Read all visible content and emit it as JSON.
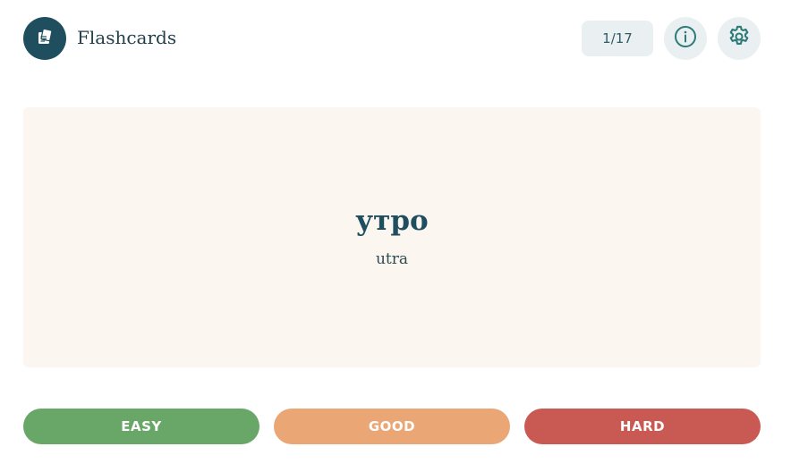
{
  "header": {
    "app_title": "Flashcards",
    "logo_icon": "notes-icon",
    "counter": "1/17",
    "info_icon": "info-icon",
    "settings_icon": "gear-icon"
  },
  "card": {
    "word": "утро",
    "transliteration": "utra"
  },
  "ratings": {
    "easy_label": "EASY",
    "good_label": "GOOD",
    "hard_label": "HARD"
  },
  "colors": {
    "primary": "#1f4e5f",
    "card_background": "#fbf6f0",
    "button_neutral": "#eaf0f1",
    "easy": "#68a767",
    "good": "#eba675",
    "hard": "#c95a53"
  }
}
